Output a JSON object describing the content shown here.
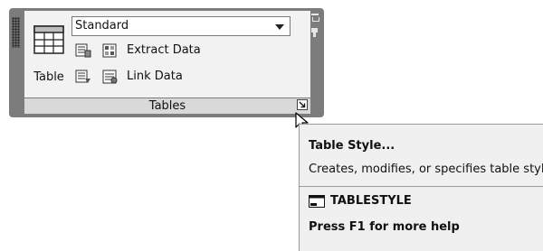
{
  "panel": {
    "title": "Tables",
    "table_button_label": "Table",
    "table_style_value": "Standard",
    "tools": [
      {
        "label": "Extract Data",
        "icon": "extract-data-icon"
      },
      {
        "label": "Link Data",
        "icon": "link-data-icon"
      }
    ],
    "dialog_launcher_icon": "dialog-launcher-arrow-icon"
  },
  "tooltip": {
    "title": "Table Style...",
    "description": "Creates, modifies, or specifies table styles",
    "command": "TABLESTYLE",
    "help": "Press F1 for more help"
  }
}
